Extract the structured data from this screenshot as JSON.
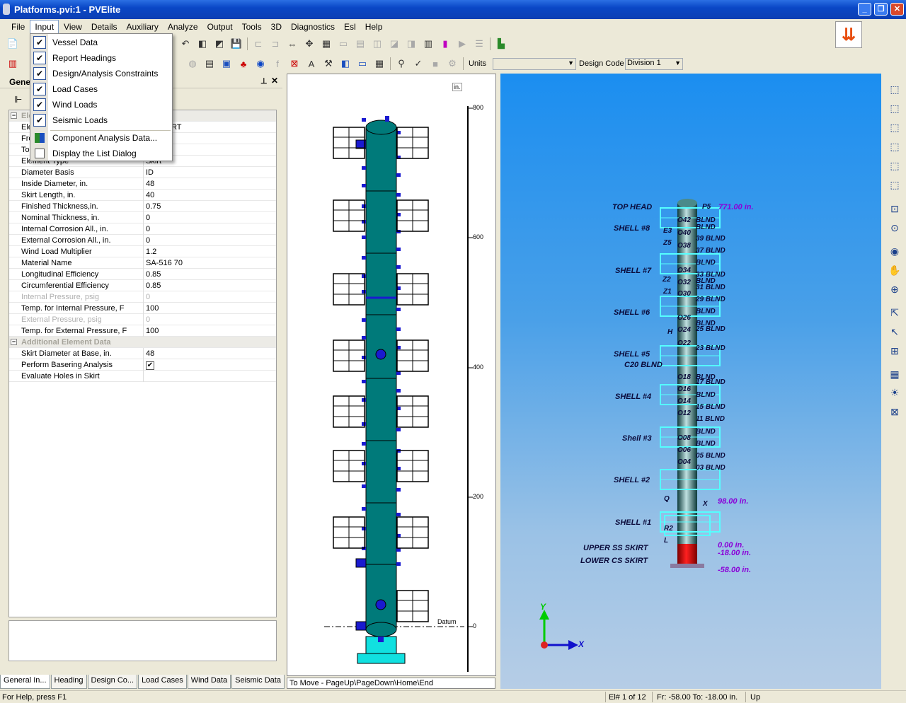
{
  "window": {
    "title": "Platforms.pvi:1 - PVElite"
  },
  "menu": [
    "File",
    "Input",
    "View",
    "Details",
    "Auxiliary",
    "Analyze",
    "Output",
    "Tools",
    "3D",
    "Diagnostics",
    "Esl",
    "Help"
  ],
  "toolbar": {
    "units_label": "Units",
    "units_value": "",
    "design_code_label": "Design Code",
    "design_code_value": "Division 1"
  },
  "input_menu": {
    "items": [
      {
        "label": "Vessel Data",
        "checked": true
      },
      {
        "label": "Report Headings",
        "checked": true
      },
      {
        "label": "Design/Analysis Constraints",
        "checked": true
      },
      {
        "label": "Load Cases",
        "checked": true
      },
      {
        "label": "Wind Loads",
        "checked": true
      },
      {
        "label": "Seismic Loads",
        "checked": true
      }
    ],
    "component_analysis": "Component Analysis Data...",
    "list_dialog": "Display the List Dialog"
  },
  "panel": {
    "title": "Gene",
    "rows": [
      {
        "key": "Ele",
        "value": "",
        "type": "cat"
      },
      {
        "key": "Ele",
        "value": "CS SKIRT"
      },
      {
        "key": "Fro",
        "value": ""
      },
      {
        "key": "To",
        "value": ""
      },
      {
        "key": "Element Type",
        "value": "Skirt"
      },
      {
        "key": "Diameter Basis",
        "value": "ID"
      },
      {
        "key": "Inside Diameter, in.",
        "value": "48"
      },
      {
        "key": "Skirt Length, in.",
        "value": "40"
      },
      {
        "key": "Finished Thickness,in.",
        "value": "0.75"
      },
      {
        "key": "Nominal Thickness, in.",
        "value": "0"
      },
      {
        "key": "Internal Corrosion All., in.",
        "value": "0"
      },
      {
        "key": "External Corrosion All., in.",
        "value": "0"
      },
      {
        "key": "Wind Load Multiplier",
        "value": "1.2"
      },
      {
        "key": "Material Name",
        "value": "SA-516 70"
      },
      {
        "key": "Longitudinal Efficiency",
        "value": "0.85"
      },
      {
        "key": "Circumferential Efficiency",
        "value": "0.85"
      },
      {
        "key": "Internal Pressure, psig",
        "value": "0",
        "type": "dis"
      },
      {
        "key": "Temp. for Internal Pressure, F",
        "value": "100"
      },
      {
        "key": "External Pressure, psig",
        "value": "0",
        "type": "dis"
      },
      {
        "key": "Temp. for External Pressure, F",
        "value": "100"
      },
      {
        "key": "Additional Element Data",
        "value": "",
        "type": "cat"
      },
      {
        "key": "Skirt Diameter at Base, in.",
        "value": "48"
      },
      {
        "key": "Perform Basering Analysis",
        "value": "",
        "type": "check"
      },
      {
        "key": "Evaluate Holes in Skirt",
        "value": ""
      }
    ],
    "tabs": [
      "General In...",
      "Heading",
      "Design Co...",
      "Load Cases",
      "Wind Data",
      "Seismic Data"
    ]
  },
  "drawing": {
    "unit": "in.",
    "ticks": [
      "800",
      "600",
      "400",
      "200",
      "0"
    ],
    "datum": "Datum",
    "hint": "To Move - PageUp\\PageDown\\Home\\End"
  },
  "view3d": {
    "labels": [
      "TOP HEAD",
      "SHELL #8",
      "SHELL #7",
      "SHELL #6",
      "SHELL #5",
      "C20 BLND",
      "SHELL #4",
      "Shell #3",
      "SHELL #2",
      "SHELL #1",
      "UPPER SS SKIRT",
      "LOWER CS SKIRT"
    ],
    "elevations": [
      "771.00 in.",
      "98.00 in.",
      "0.00 in.",
      "-18.00 in.",
      "-58.00 in."
    ],
    "nozzles": [
      "O42",
      "O40",
      "O38",
      "O34",
      "O32",
      "O30",
      "O26",
      "O24",
      "O22",
      "O18",
      "O16",
      "O14",
      "O12",
      "O08",
      "O06",
      "O04",
      "E3",
      "Z5",
      "Z2",
      "Z1",
      "H",
      "Q",
      "X",
      "L",
      "R2",
      "P5"
    ],
    "blinds": [
      "BLND",
      "BLND",
      "39 BLND",
      "37 BLND",
      "BLND",
      "33 BLND",
      "BLND",
      "31 BLND",
      "29 BLND",
      "BLND",
      "BLND",
      "25 BLND",
      "23 BLND",
      "BLND",
      "17 BLND",
      "BLND",
      "15 BLND",
      "11 BLND",
      "BLND",
      "BLND",
      "05 BLND",
      "03 BLND"
    ],
    "axis": {
      "x": "X",
      "y": "Y"
    }
  },
  "status": {
    "help": "For Help, press F1",
    "element": "El# 1 of 12",
    "range": "Fr: -58.00 To: -18.00 in.",
    "mode": "Up"
  },
  "colors": {
    "vessel": "#007a7a",
    "skirt": "#11e0e0",
    "nozzle": "#1a1ad0",
    "sky": "#1b8ef0",
    "elev": "#8a00d8"
  }
}
